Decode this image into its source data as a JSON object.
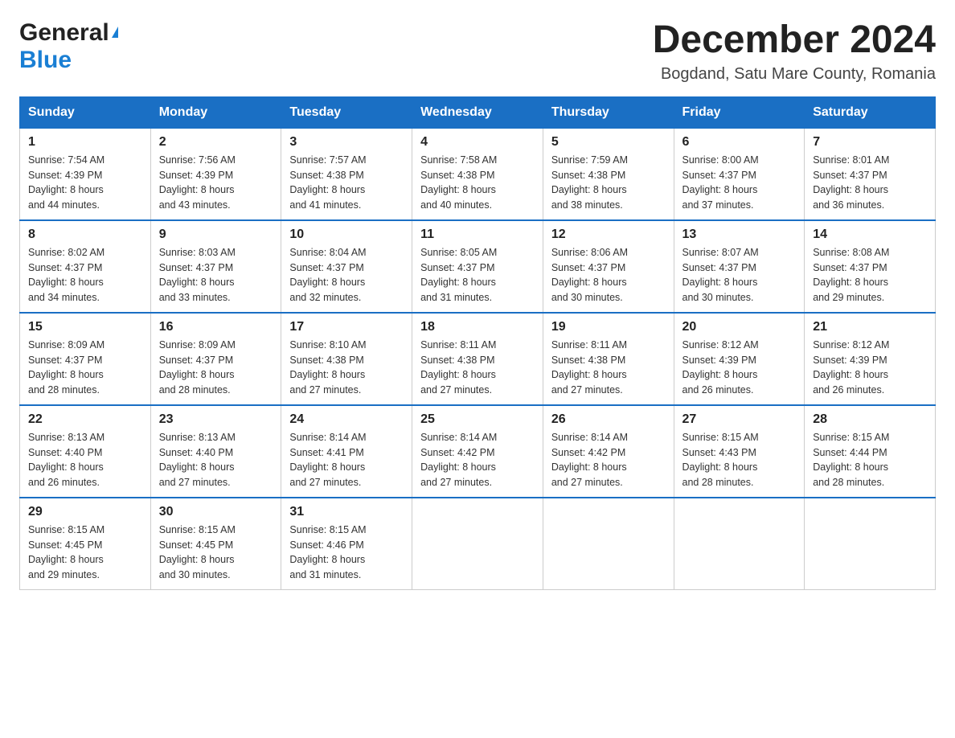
{
  "logo": {
    "general": "General",
    "blue": "Blue"
  },
  "title": "December 2024",
  "location": "Bogdand, Satu Mare County, Romania",
  "days_of_week": [
    "Sunday",
    "Monday",
    "Tuesday",
    "Wednesday",
    "Thursday",
    "Friday",
    "Saturday"
  ],
  "weeks": [
    [
      {
        "day": "1",
        "sunrise": "Sunrise: 7:54 AM",
        "sunset": "Sunset: 4:39 PM",
        "daylight": "Daylight: 8 hours",
        "daylight2": "and 44 minutes."
      },
      {
        "day": "2",
        "sunrise": "Sunrise: 7:56 AM",
        "sunset": "Sunset: 4:39 PM",
        "daylight": "Daylight: 8 hours",
        "daylight2": "and 43 minutes."
      },
      {
        "day": "3",
        "sunrise": "Sunrise: 7:57 AM",
        "sunset": "Sunset: 4:38 PM",
        "daylight": "Daylight: 8 hours",
        "daylight2": "and 41 minutes."
      },
      {
        "day": "4",
        "sunrise": "Sunrise: 7:58 AM",
        "sunset": "Sunset: 4:38 PM",
        "daylight": "Daylight: 8 hours",
        "daylight2": "and 40 minutes."
      },
      {
        "day": "5",
        "sunrise": "Sunrise: 7:59 AM",
        "sunset": "Sunset: 4:38 PM",
        "daylight": "Daylight: 8 hours",
        "daylight2": "and 38 minutes."
      },
      {
        "day": "6",
        "sunrise": "Sunrise: 8:00 AM",
        "sunset": "Sunset: 4:37 PM",
        "daylight": "Daylight: 8 hours",
        "daylight2": "and 37 minutes."
      },
      {
        "day": "7",
        "sunrise": "Sunrise: 8:01 AM",
        "sunset": "Sunset: 4:37 PM",
        "daylight": "Daylight: 8 hours",
        "daylight2": "and 36 minutes."
      }
    ],
    [
      {
        "day": "8",
        "sunrise": "Sunrise: 8:02 AM",
        "sunset": "Sunset: 4:37 PM",
        "daylight": "Daylight: 8 hours",
        "daylight2": "and 34 minutes."
      },
      {
        "day": "9",
        "sunrise": "Sunrise: 8:03 AM",
        "sunset": "Sunset: 4:37 PM",
        "daylight": "Daylight: 8 hours",
        "daylight2": "and 33 minutes."
      },
      {
        "day": "10",
        "sunrise": "Sunrise: 8:04 AM",
        "sunset": "Sunset: 4:37 PM",
        "daylight": "Daylight: 8 hours",
        "daylight2": "and 32 minutes."
      },
      {
        "day": "11",
        "sunrise": "Sunrise: 8:05 AM",
        "sunset": "Sunset: 4:37 PM",
        "daylight": "Daylight: 8 hours",
        "daylight2": "and 31 minutes."
      },
      {
        "day": "12",
        "sunrise": "Sunrise: 8:06 AM",
        "sunset": "Sunset: 4:37 PM",
        "daylight": "Daylight: 8 hours",
        "daylight2": "and 30 minutes."
      },
      {
        "day": "13",
        "sunrise": "Sunrise: 8:07 AM",
        "sunset": "Sunset: 4:37 PM",
        "daylight": "Daylight: 8 hours",
        "daylight2": "and 30 minutes."
      },
      {
        "day": "14",
        "sunrise": "Sunrise: 8:08 AM",
        "sunset": "Sunset: 4:37 PM",
        "daylight": "Daylight: 8 hours",
        "daylight2": "and 29 minutes."
      }
    ],
    [
      {
        "day": "15",
        "sunrise": "Sunrise: 8:09 AM",
        "sunset": "Sunset: 4:37 PM",
        "daylight": "Daylight: 8 hours",
        "daylight2": "and 28 minutes."
      },
      {
        "day": "16",
        "sunrise": "Sunrise: 8:09 AM",
        "sunset": "Sunset: 4:37 PM",
        "daylight": "Daylight: 8 hours",
        "daylight2": "and 28 minutes."
      },
      {
        "day": "17",
        "sunrise": "Sunrise: 8:10 AM",
        "sunset": "Sunset: 4:38 PM",
        "daylight": "Daylight: 8 hours",
        "daylight2": "and 27 minutes."
      },
      {
        "day": "18",
        "sunrise": "Sunrise: 8:11 AM",
        "sunset": "Sunset: 4:38 PM",
        "daylight": "Daylight: 8 hours",
        "daylight2": "and 27 minutes."
      },
      {
        "day": "19",
        "sunrise": "Sunrise: 8:11 AM",
        "sunset": "Sunset: 4:38 PM",
        "daylight": "Daylight: 8 hours",
        "daylight2": "and 27 minutes."
      },
      {
        "day": "20",
        "sunrise": "Sunrise: 8:12 AM",
        "sunset": "Sunset: 4:39 PM",
        "daylight": "Daylight: 8 hours",
        "daylight2": "and 26 minutes."
      },
      {
        "day": "21",
        "sunrise": "Sunrise: 8:12 AM",
        "sunset": "Sunset: 4:39 PM",
        "daylight": "Daylight: 8 hours",
        "daylight2": "and 26 minutes."
      }
    ],
    [
      {
        "day": "22",
        "sunrise": "Sunrise: 8:13 AM",
        "sunset": "Sunset: 4:40 PM",
        "daylight": "Daylight: 8 hours",
        "daylight2": "and 26 minutes."
      },
      {
        "day": "23",
        "sunrise": "Sunrise: 8:13 AM",
        "sunset": "Sunset: 4:40 PM",
        "daylight": "Daylight: 8 hours",
        "daylight2": "and 27 minutes."
      },
      {
        "day": "24",
        "sunrise": "Sunrise: 8:14 AM",
        "sunset": "Sunset: 4:41 PM",
        "daylight": "Daylight: 8 hours",
        "daylight2": "and 27 minutes."
      },
      {
        "day": "25",
        "sunrise": "Sunrise: 8:14 AM",
        "sunset": "Sunset: 4:42 PM",
        "daylight": "Daylight: 8 hours",
        "daylight2": "and 27 minutes."
      },
      {
        "day": "26",
        "sunrise": "Sunrise: 8:14 AM",
        "sunset": "Sunset: 4:42 PM",
        "daylight": "Daylight: 8 hours",
        "daylight2": "and 27 minutes."
      },
      {
        "day": "27",
        "sunrise": "Sunrise: 8:15 AM",
        "sunset": "Sunset: 4:43 PM",
        "daylight": "Daylight: 8 hours",
        "daylight2": "and 28 minutes."
      },
      {
        "day": "28",
        "sunrise": "Sunrise: 8:15 AM",
        "sunset": "Sunset: 4:44 PM",
        "daylight": "Daylight: 8 hours",
        "daylight2": "and 28 minutes."
      }
    ],
    [
      {
        "day": "29",
        "sunrise": "Sunrise: 8:15 AM",
        "sunset": "Sunset: 4:45 PM",
        "daylight": "Daylight: 8 hours",
        "daylight2": "and 29 minutes."
      },
      {
        "day": "30",
        "sunrise": "Sunrise: 8:15 AM",
        "sunset": "Sunset: 4:45 PM",
        "daylight": "Daylight: 8 hours",
        "daylight2": "and 30 minutes."
      },
      {
        "day": "31",
        "sunrise": "Sunrise: 8:15 AM",
        "sunset": "Sunset: 4:46 PM",
        "daylight": "Daylight: 8 hours",
        "daylight2": "and 31 minutes."
      },
      null,
      null,
      null,
      null
    ]
  ]
}
